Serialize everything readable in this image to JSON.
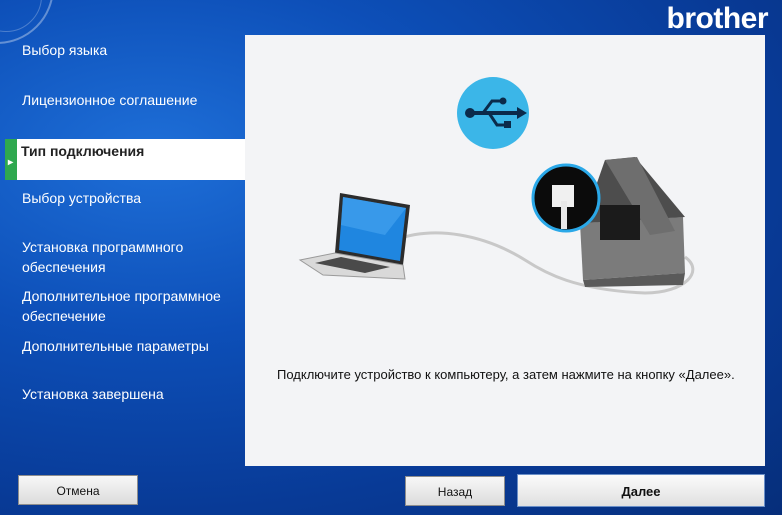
{
  "brand": {
    "logo_text": "brother"
  },
  "sidebar": {
    "steps": [
      {
        "label": "Выбор языка"
      },
      {
        "label": "Лицензионное соглашение"
      },
      {
        "label": "Тип подключения"
      },
      {
        "label": "Выбор устройства"
      },
      {
        "label": "Установка программного обеспечения"
      },
      {
        "label": "Дополнительное программное обеспечение"
      },
      {
        "label": "Дополнительные параметры"
      },
      {
        "label": "Установка завершена"
      }
    ]
  },
  "main": {
    "instruction": "Подключите устройство к компьютеру, а затем нажмите на кнопку «Далее».",
    "illustration": {
      "icons": [
        "usb-icon",
        "laptop-icon",
        "printer-icon"
      ]
    }
  },
  "footer": {
    "cancel_label": "Отмена",
    "back_label": "Назад",
    "next_label": "Далее"
  },
  "colors": {
    "active_step_marker": "#2fa84f",
    "usb_badge": "#3bb6e8",
    "background": "#0d4fb8"
  }
}
